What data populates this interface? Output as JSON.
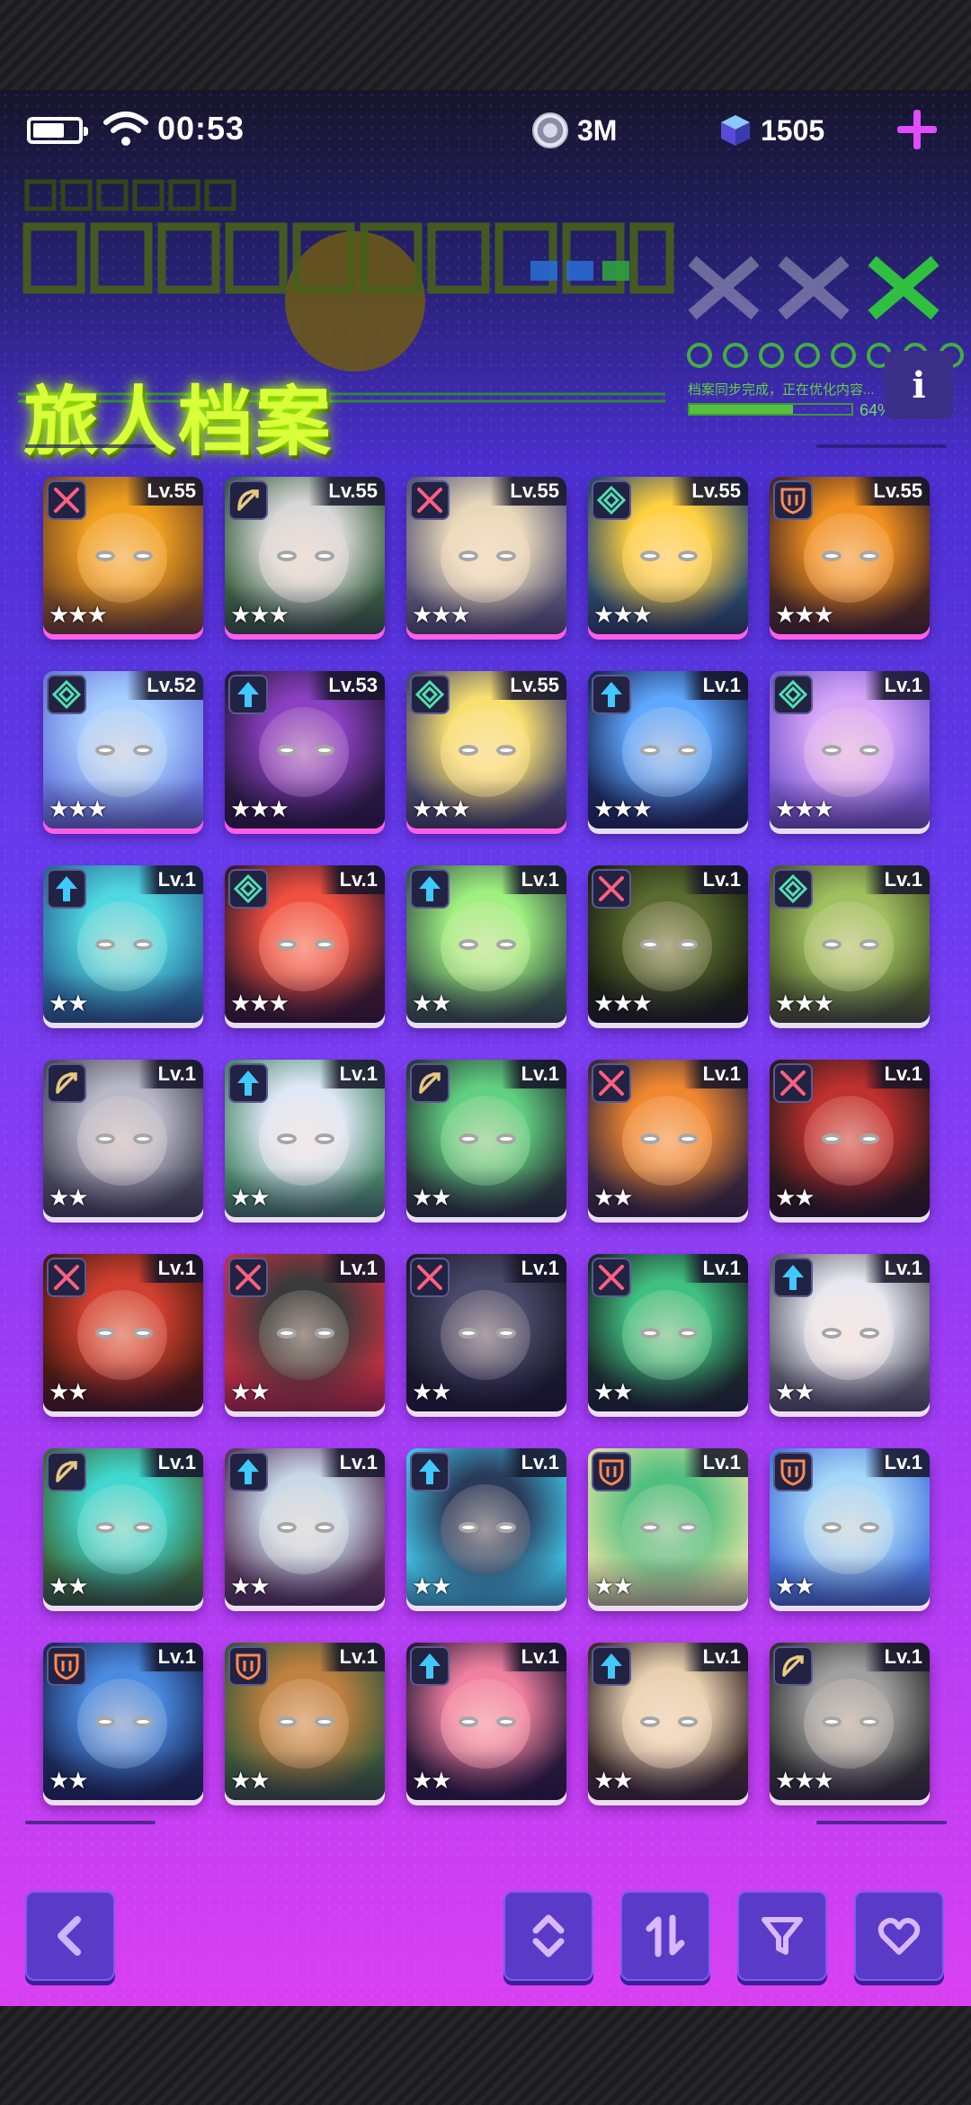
{
  "status_bar": {
    "time": "00:53"
  },
  "currency": {
    "coins": "3M",
    "gems": "1505",
    "coin_icon": "coin-icon",
    "gem_icon": "gem-cube-icon",
    "add_icon": "plus-icon"
  },
  "banner": {
    "title": "旅人档案",
    "progress_text": "档案同步完成，正在优化内容...",
    "progress_percent": "64%",
    "progress_fraction": 0.64
  },
  "info_button": {
    "label": "i"
  },
  "colors": {
    "accent": "#e04cff",
    "title_green": "#d8ff3a",
    "button": "#5a3bc8"
  },
  "characters": [
    {
      "level": "Lv.55",
      "stars": 3,
      "class_icon": "crossed-swords-icon",
      "palette": [
        "#f0a020",
        "#7a4a20"
      ],
      "highlight": true
    },
    {
      "level": "Lv.55",
      "stars": 3,
      "class_icon": "bow-icon",
      "palette": [
        "#d8d8d8",
        "#3a6040"
      ],
      "highlight": true
    },
    {
      "level": "Lv.55",
      "stars": 3,
      "class_icon": "crossed-swords-icon",
      "palette": [
        "#e8d8b8",
        "#5a5878"
      ],
      "highlight": true
    },
    {
      "level": "Lv.55",
      "stars": 3,
      "class_icon": "diamond-icon",
      "palette": [
        "#ffd040",
        "#2a4a6a"
      ],
      "highlight": true
    },
    {
      "level": "Lv.55",
      "stars": 3,
      "class_icon": "shield-icon",
      "palette": [
        "#f09020",
        "#4a2a20"
      ],
      "highlight": true
    },
    {
      "level": "Lv.52",
      "stars": 3,
      "class_icon": "diamond-icon",
      "palette": [
        "#a8d0ff",
        "#6a7adf"
      ],
      "highlight": true
    },
    {
      "level": "Lv.53",
      "stars": 3,
      "class_icon": "arrow-up-icon",
      "palette": [
        "#8a40c0",
        "#2a1a40"
      ],
      "highlight": true
    },
    {
      "level": "Lv.55",
      "stars": 3,
      "class_icon": "diamond-icon",
      "palette": [
        "#f8e070",
        "#4a4a6a"
      ],
      "highlight": true
    },
    {
      "level": "Lv.1",
      "stars": 3,
      "class_icon": "arrow-up-icon",
      "palette": [
        "#60a8ff",
        "#1a2a5a"
      ],
      "highlight": false
    },
    {
      "level": "Lv.1",
      "stars": 3,
      "class_icon": "diamond-icon",
      "palette": [
        "#d8a8f8",
        "#7a5ad0"
      ],
      "highlight": false
    },
    {
      "level": "Lv.1",
      "stars": 2,
      "class_icon": "arrow-up-icon",
      "palette": [
        "#50d8e0",
        "#2a6a9a"
      ],
      "highlight": false
    },
    {
      "level": "Lv.1",
      "stars": 3,
      "class_icon": "diamond-icon",
      "palette": [
        "#f05040",
        "#3a1a2a"
      ],
      "highlight": false
    },
    {
      "level": "Lv.1",
      "stars": 2,
      "class_icon": "arrow-up-icon",
      "palette": [
        "#a0f080",
        "#3a5a4a"
      ],
      "highlight": false
    },
    {
      "level": "Lv.1",
      "stars": 3,
      "class_icon": "crossed-swords-icon",
      "palette": [
        "#5a6a30",
        "#1a2010"
      ],
      "highlight": false
    },
    {
      "level": "Lv.1",
      "stars": 3,
      "class_icon": "diamond-icon",
      "palette": [
        "#a0c060",
        "#4a5a2a"
      ],
      "highlight": false
    },
    {
      "level": "Lv.1",
      "stars": 2,
      "class_icon": "bow-icon",
      "palette": [
        "#b8b8c8",
        "#4a4a5a"
      ],
      "highlight": false
    },
    {
      "level": "Lv.1",
      "stars": 2,
      "class_icon": "arrow-up-icon",
      "palette": [
        "#e0e8f8",
        "#4a8a6a"
      ],
      "highlight": false
    },
    {
      "level": "Lv.1",
      "stars": 2,
      "class_icon": "bow-icon",
      "palette": [
        "#60d080",
        "#2a3a3a"
      ],
      "highlight": false
    },
    {
      "level": "Lv.1",
      "stars": 2,
      "class_icon": "crossed-swords-icon",
      "palette": [
        "#f08830",
        "#3a2a3a"
      ],
      "highlight": false
    },
    {
      "level": "Lv.1",
      "stars": 2,
      "class_icon": "crossed-swords-icon",
      "palette": [
        "#c03030",
        "#2a1a1a"
      ],
      "highlight": false
    },
    {
      "level": "Lv.1",
      "stars": 2,
      "class_icon": "crossed-swords-icon",
      "palette": [
        "#d04030",
        "#4a1a10"
      ],
      "highlight": false
    },
    {
      "level": "Lv.1",
      "stars": 2,
      "class_icon": "crossed-swords-icon",
      "palette": [
        "#3a3a3a",
        "#c03040"
      ],
      "highlight": false
    },
    {
      "level": "Lv.1",
      "stars": 2,
      "class_icon": "crossed-swords-icon",
      "palette": [
        "#4a4a6a",
        "#1a1a2a"
      ],
      "highlight": false
    },
    {
      "level": "Lv.1",
      "stars": 2,
      "class_icon": "crossed-swords-icon",
      "palette": [
        "#40c080",
        "#1a2a2a"
      ],
      "highlight": false
    },
    {
      "level": "Lv.1",
      "stars": 2,
      "class_icon": "arrow-up-icon",
      "palette": [
        "#e8e8f0",
        "#5a5a6a"
      ],
      "highlight": false
    },
    {
      "level": "Lv.1",
      "stars": 2,
      "class_icon": "bow-icon",
      "palette": [
        "#40d8d0",
        "#3a6a3a"
      ],
      "highlight": false
    },
    {
      "level": "Lv.1",
      "stars": 2,
      "class_icon": "arrow-up-icon",
      "palette": [
        "#c8d8e8",
        "#5a3a5a"
      ],
      "highlight": false
    },
    {
      "level": "Lv.1",
      "stars": 2,
      "class_icon": "arrow-up-icon",
      "palette": [
        "#2a3a5a",
        "#40c0e0"
      ],
      "highlight": false
    },
    {
      "level": "Lv.1",
      "stars": 2,
      "class_icon": "shield-icon",
      "palette": [
        "#50c080",
        "#d8e0a0"
      ],
      "highlight": false
    },
    {
      "level": "Lv.1",
      "stars": 2,
      "class_icon": "shield-icon",
      "palette": [
        "#a8d8f8",
        "#4a7adf"
      ],
      "highlight": false
    },
    {
      "level": "Lv.1",
      "stars": 2,
      "class_icon": "shield-icon",
      "palette": [
        "#4a8ae0",
        "#1a2a5a"
      ],
      "highlight": false
    },
    {
      "level": "Lv.1",
      "stars": 2,
      "class_icon": "shield-icon",
      "palette": [
        "#c08040",
        "#3a5a3a"
      ],
      "highlight": false
    },
    {
      "level": "Lv.1",
      "stars": 2,
      "class_icon": "arrow-up-icon",
      "palette": [
        "#f080a0",
        "#2a1a3a"
      ],
      "highlight": false
    },
    {
      "level": "Lv.1",
      "stars": 2,
      "class_icon": "arrow-up-icon",
      "palette": [
        "#e8d0b0",
        "#3a2a2a"
      ],
      "highlight": false
    },
    {
      "level": "Lv.1",
      "stars": 3,
      "class_icon": "bow-icon",
      "palette": [
        "#a0a0a0",
        "#303030"
      ],
      "highlight": false
    }
  ],
  "bottom_buttons": {
    "back": "chevron-left-icon",
    "sort_order": "sort-updown-icon",
    "sort_swap": "swap-arrows-icon",
    "filter": "filter-funnel-icon",
    "favorite": "heart-icon"
  }
}
